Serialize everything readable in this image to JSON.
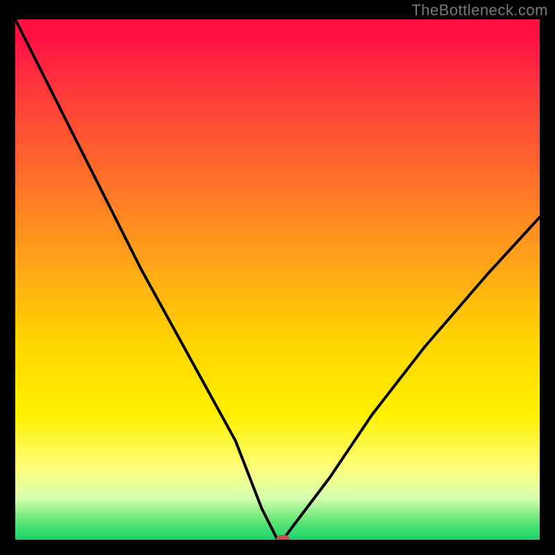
{
  "watermark": "TheBottleneck.com",
  "chart_data": {
    "type": "line",
    "title": "",
    "xlabel": "",
    "ylabel": "",
    "xlim": [
      0,
      100
    ],
    "ylim": [
      0,
      100
    ],
    "grid": false,
    "series": [
      {
        "name": "bottleneck-curve",
        "x": [
          0,
          6,
          12,
          18,
          24,
          30,
          36,
          42,
          47,
          50,
          51,
          54,
          60,
          68,
          78,
          90,
          100
        ],
        "values": [
          100,
          88,
          76,
          64,
          52,
          41,
          30,
          19,
          6,
          0,
          0,
          4,
          12,
          24,
          37,
          51,
          62
        ]
      }
    ],
    "marker": {
      "x": 51,
      "y": 0,
      "color": "#c1564e"
    },
    "gradient_stops": [
      {
        "pct": 0,
        "color": "#ff1243"
      },
      {
        "pct": 14,
        "color": "#ff3a3a"
      },
      {
        "pct": 30,
        "color": "#ff6d2a"
      },
      {
        "pct": 46,
        "color": "#ffa21a"
      },
      {
        "pct": 62,
        "color": "#ffd400"
      },
      {
        "pct": 76,
        "color": "#fff000"
      },
      {
        "pct": 86,
        "color": "#feff7a"
      },
      {
        "pct": 92,
        "color": "#d7ffb0"
      },
      {
        "pct": 96,
        "color": "#6be87a"
      },
      {
        "pct": 100,
        "color": "#18d36a"
      }
    ]
  }
}
